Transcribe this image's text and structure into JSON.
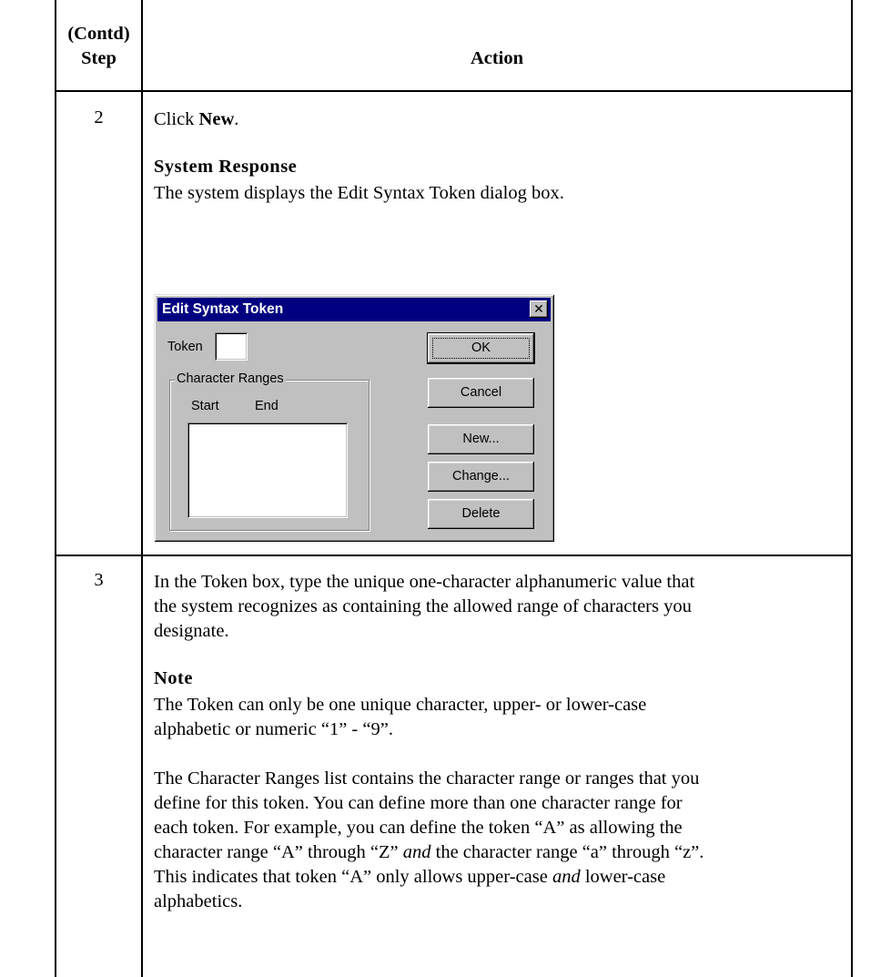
{
  "table": {
    "header": {
      "step_line1": "(Contd)",
      "step_line2": "Step",
      "action": "Action"
    },
    "rows": [
      {
        "step": "2",
        "instruction_pre": "Click ",
        "instruction_bold": "New",
        "instruction_post": ".",
        "response_heading": "System Response",
        "response_text": "The system displays the Edit Syntax Token dialog box."
      },
      {
        "step": "3",
        "line1": "In the Token box, type the unique one-character alphanumeric value that",
        "line2": "the system recognizes as containing the allowed range of characters you",
        "line3": "designate.",
        "note_heading": "Note",
        "note_line1": "The Token can only be one unique character, upper- or lower-case",
        "note_line2": "alphabetic or numeric “1” - “9”.",
        "p_line1": "The Character Ranges list contains the character range or ranges that you",
        "p_line2": "define for this token. You can define more than one character range for",
        "p_line3": "each token. For example, you can define the token “A” as allowing the",
        "p_line4_a": "character range “A” through “Z” ",
        "p_line4_and": "and",
        "p_line4_b": " the character range “a” through “z”.",
        "p_line5_a": "This indicates that token “A” only allows upper-case ",
        "p_line5_and": "and",
        "p_line5_b": " lower-case",
        "p_line6": "alphabetics."
      }
    ]
  },
  "dialog": {
    "title": "Edit Syntax Token",
    "close_glyph": "✕",
    "token_label": "Token",
    "token_value": "",
    "group_label": "Character Ranges",
    "col_start": "Start",
    "col_end": "End",
    "buttons": {
      "ok": "OK",
      "cancel": "Cancel",
      "new": "New...",
      "change": "Change...",
      "delete": "Delete"
    }
  }
}
